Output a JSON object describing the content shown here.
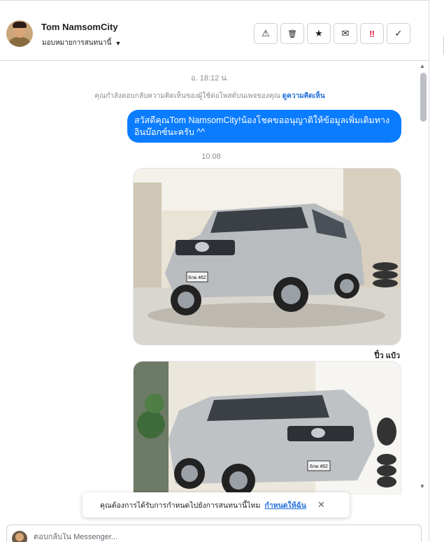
{
  "header": {
    "contact_name": "Tom NamsomCity",
    "assign_label": "มอบหมายการสนทนานี้"
  },
  "actions": [
    {
      "name": "report-button",
      "icon": "warning-icon",
      "glyph": "⚠"
    },
    {
      "name": "delete-button",
      "icon": "trash-icon",
      "glyph": "🗑"
    },
    {
      "name": "star-button",
      "icon": "star-icon",
      "glyph": "★"
    },
    {
      "name": "mark-unread-button",
      "icon": "envelope-open-icon",
      "glyph": "✉"
    },
    {
      "name": "spam-button",
      "icon": "spam-icon",
      "glyph": "‼"
    },
    {
      "name": "mark-done-button",
      "icon": "check-icon",
      "glyph": "✓"
    }
  ],
  "chat": {
    "timestamp_1": "อ. 18:12 น.",
    "reply_notice": "คุณกำลังตอบกลับความคิดเห็นของผู้ใช้ต่อโพสต์บนเพจของคุณ",
    "reply_notice_link": "ดูความคิดเห็น",
    "outgoing_message": "สวัสดีคุณTom NamsomCity!น้องโชคขออนุญาติให้ข้อมูลเพิ่มเติมทางอินบ๊อกซ์นะครับ ^^",
    "timestamp_2": "10:08",
    "photo_caption": "ปิ๋ว แป๋ว",
    "plate_text": "6กผ 462"
  },
  "toast": {
    "text": "คุณต้องการได้รับการกำหนดไปยังการสนทนานี้ไหม",
    "link": "กำหนดให้ฉัน"
  },
  "reply_box": {
    "placeholder": "ตอบกลับใน Messenger..."
  },
  "colors": {
    "bubble": "#0a7cff",
    "link": "#216fdb",
    "spam": "#e41e3f"
  }
}
